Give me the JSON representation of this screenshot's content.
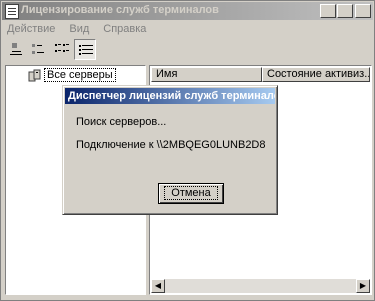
{
  "window": {
    "title": "Лицензирование служб терминалов"
  },
  "titlebar_buttons": {
    "minimize": "_",
    "maximize": "□",
    "close": "×"
  },
  "menu": [
    "Действие",
    "Вид",
    "Справка"
  ],
  "toolbar": {
    "icons": [
      "large-icons-icon",
      "small-icons-icon",
      "list-view-icon",
      "details-view-icon"
    ]
  },
  "tree": {
    "root_label": "Все серверы",
    "icon": "server-group-icon"
  },
  "list": {
    "columns": [
      "Имя",
      "Состояние активиз..."
    ]
  },
  "dialog": {
    "title": "Диспетчер лицензий служб терминалов",
    "status": "Поиск серверов...",
    "connecting": "Подключение к \\\\2MBQEG0LUNB2D8",
    "cancel_label": "Отмена"
  },
  "scrollbar": {
    "left_arrow": "◀",
    "right_arrow": "▶"
  }
}
